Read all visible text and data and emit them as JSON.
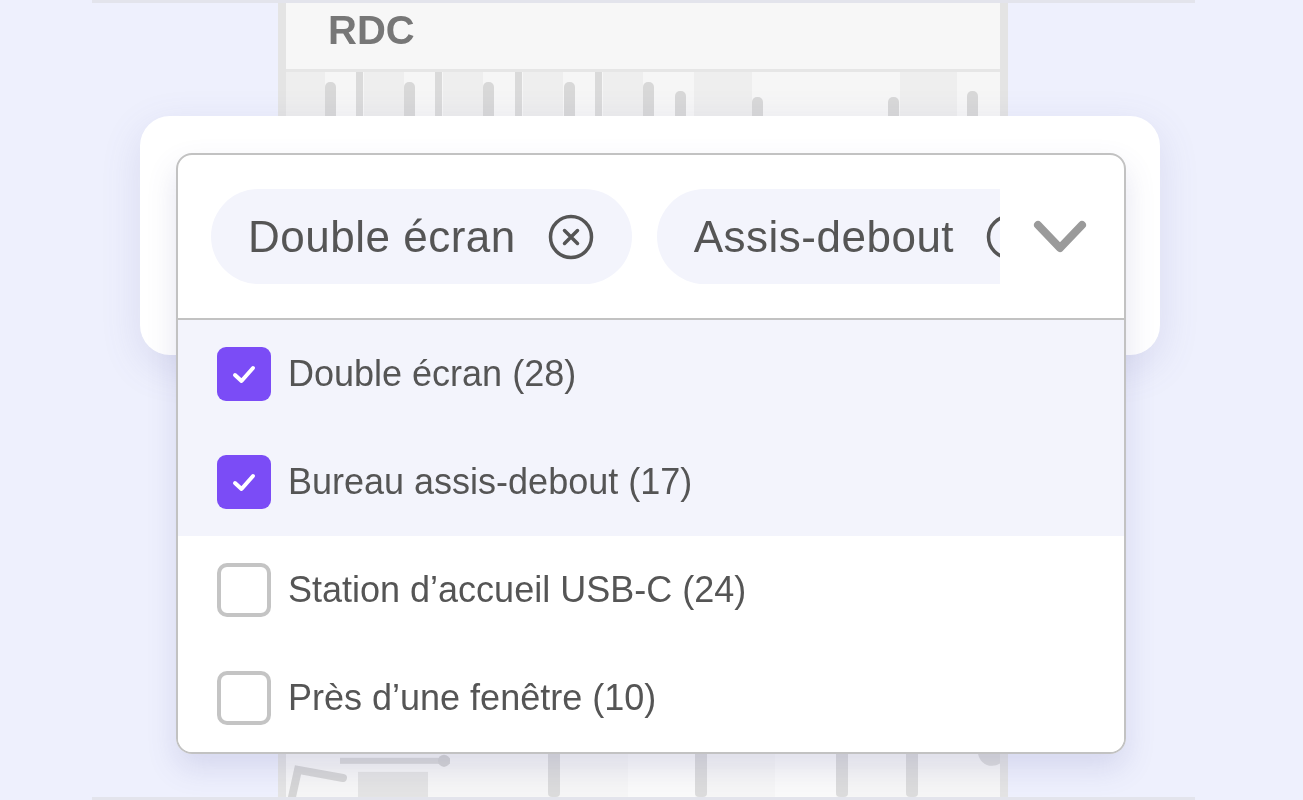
{
  "floor_plan": {
    "title": "RDC"
  },
  "filter": {
    "expanded": true,
    "chips": [
      {
        "label": "Double écran"
      },
      {
        "label": "Assis-debout"
      }
    ],
    "options": [
      {
        "label": "Double écran (28)",
        "checked": true
      },
      {
        "label": "Bureau assis-debout (17)",
        "checked": true
      },
      {
        "label": "Station d’accueil USB-C (24)",
        "checked": false
      },
      {
        "label": "Près d’une fenêtre (10)",
        "checked": false
      }
    ]
  }
}
